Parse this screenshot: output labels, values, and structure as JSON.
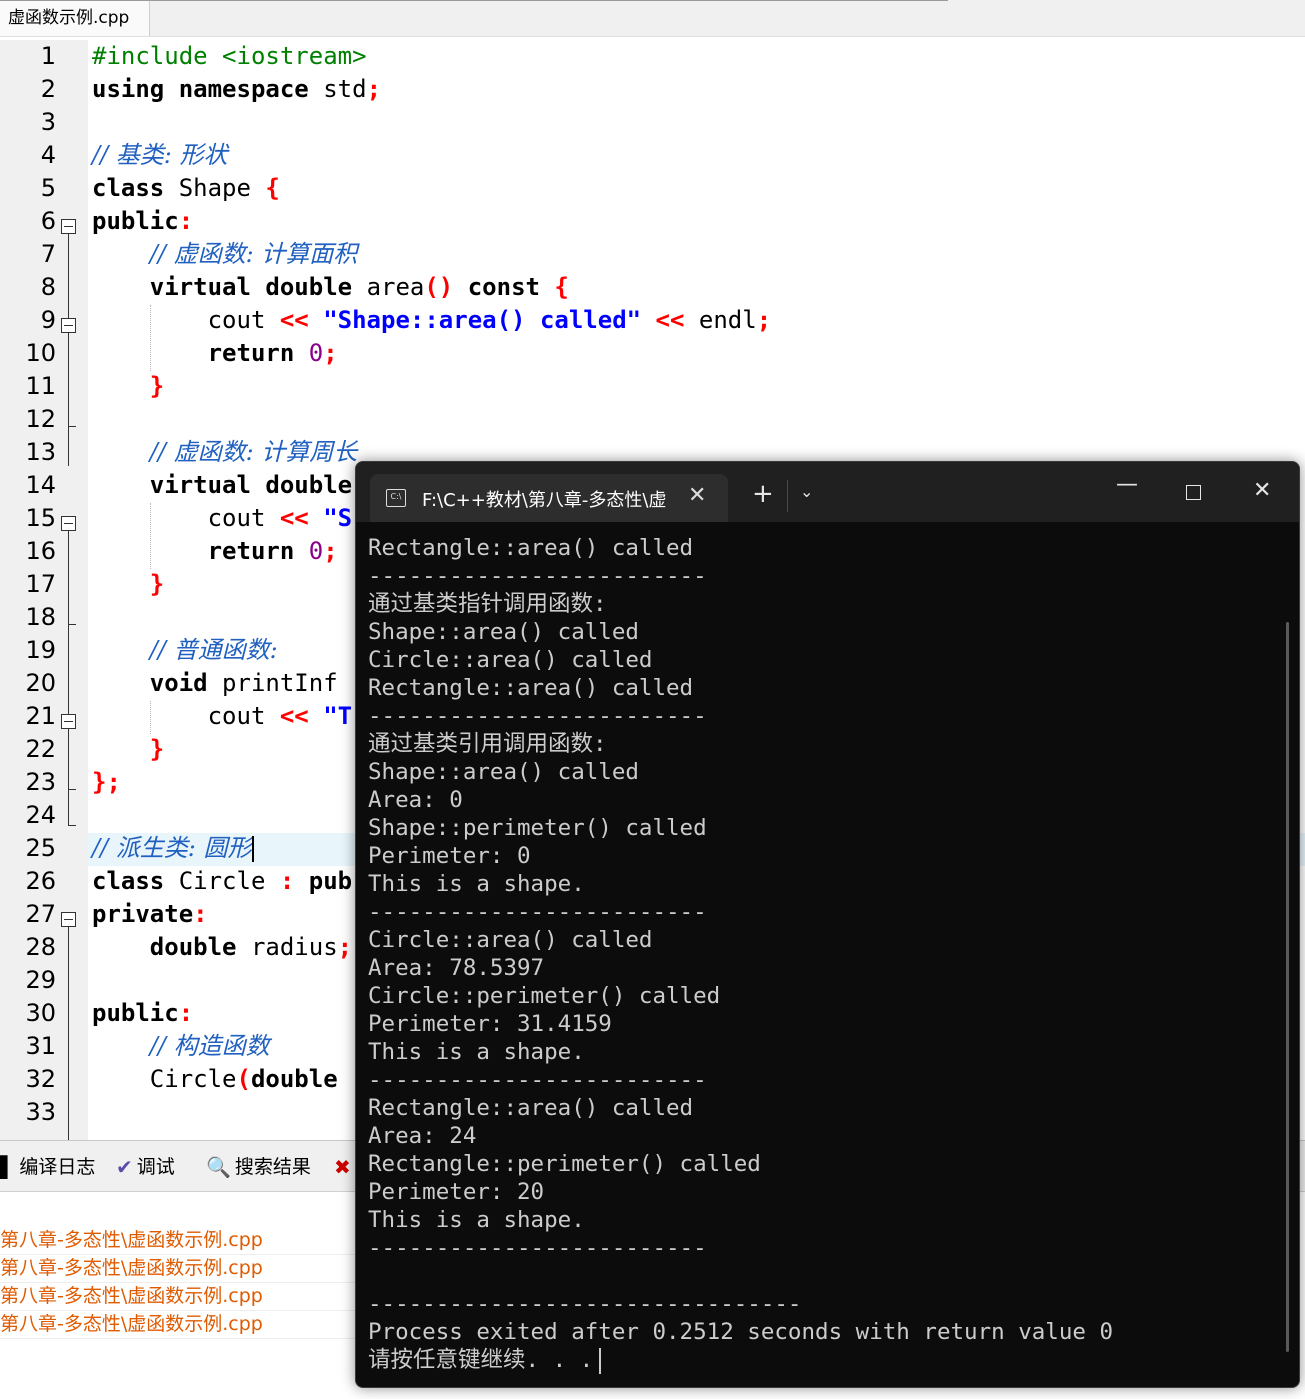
{
  "editor": {
    "file_tab": "虚函数示例.cpp",
    "line_numbers": [
      "1",
      "2",
      "3",
      "4",
      "5",
      "6",
      "7",
      "8",
      "9",
      "10",
      "11",
      "12",
      "13",
      "14",
      "15",
      "16",
      "17",
      "18",
      "19",
      "20",
      "21",
      "22",
      "23",
      "24",
      "25",
      "26",
      "27",
      "28",
      "29",
      "30",
      "31",
      "32",
      "33"
    ],
    "code": {
      "l1": "#include <iostream>",
      "l2_kw1": "using",
      "l2_kw2": "namespace",
      "l2_id": "std",
      "l4": "// 基类: 形状",
      "l5_kw": "class",
      "l5_id": "Shape",
      "l6_kw": "public",
      "l7": "// 虚函数: 计算面积",
      "l8_kw1": "virtual",
      "l8_kw2": "double",
      "l8_id": "area",
      "l8_kw3": "const",
      "l9_id": "cout",
      "l9_str": "\"Shape::area() called\"",
      "l9_id2": "endl",
      "l10_kw": "return",
      "l10_num": "0",
      "l13": "// 虚函数: 计算周长",
      "l14_kw1": "virtual",
      "l14_kw2": "double",
      "l15_id": "cout",
      "l15_str": "\"S",
      "l16_kw": "return",
      "l16_num": "0",
      "l19": "// 普通函数: ",
      "l20_kw": "void",
      "l20_id": "printInf",
      "l21_id": "cout",
      "l21_str": "\"T",
      "l25": "// 派生类: 圆形",
      "l26_kw": "class",
      "l26_id": "Circle",
      "l26_kw2": "pub",
      "l27_kw": "private",
      "l28_kw": "double",
      "l28_id": "radius",
      "l30_kw": "public",
      "l31": "// 构造函数",
      "l32_id": "Circle",
      "l32_kw": "double"
    }
  },
  "bottom_panel": {
    "tabs": [
      {
        "label": "编译日志"
      },
      {
        "label": "调试"
      },
      {
        "label": "搜索结果"
      }
    ],
    "log_rows": [
      "第八章-多态性\\虚函数示例.cpp",
      "第八章-多态性\\虚函数示例.cpp",
      "第八章-多态性\\虚函数示例.cpp",
      "第八章-多态性\\虚函数示例.cpp"
    ]
  },
  "terminal": {
    "tab_title": "F:\\C++教材\\第八章-多态性\\虚",
    "lines": [
      "Rectangle::area() called",
      "-------------------------",
      "通过基类指针调用函数:",
      "Shape::area() called",
      "Circle::area() called",
      "Rectangle::area() called",
      "-------------------------",
      "通过基类引用调用函数:",
      "Shape::area() called",
      "Area: 0",
      "Shape::perimeter() called",
      "Perimeter: 0",
      "This is a shape.",
      "-------------------------",
      "Circle::area() called",
      "Area: 78.5397",
      "Circle::perimeter() called",
      "Perimeter: 31.4159",
      "This is a shape.",
      "-------------------------",
      "Rectangle::area() called",
      "Area: 24",
      "Rectangle::perimeter() called",
      "Perimeter: 20",
      "This is a shape.",
      "-------------------------",
      "",
      "--------------------------------",
      "Process exited after 0.2512 seconds with return value 0",
      "请按任意键继续. . ."
    ]
  },
  "colors": {
    "keyword": "#000000",
    "preprocessor": "#008000",
    "comment": "#2060c0",
    "string": "#0000ff",
    "number": "#8b008b",
    "symbol": "#ff0000",
    "terminal_bg": "#0c0c0c",
    "terminal_text": "#cccccc",
    "log_text": "#e05a00"
  }
}
